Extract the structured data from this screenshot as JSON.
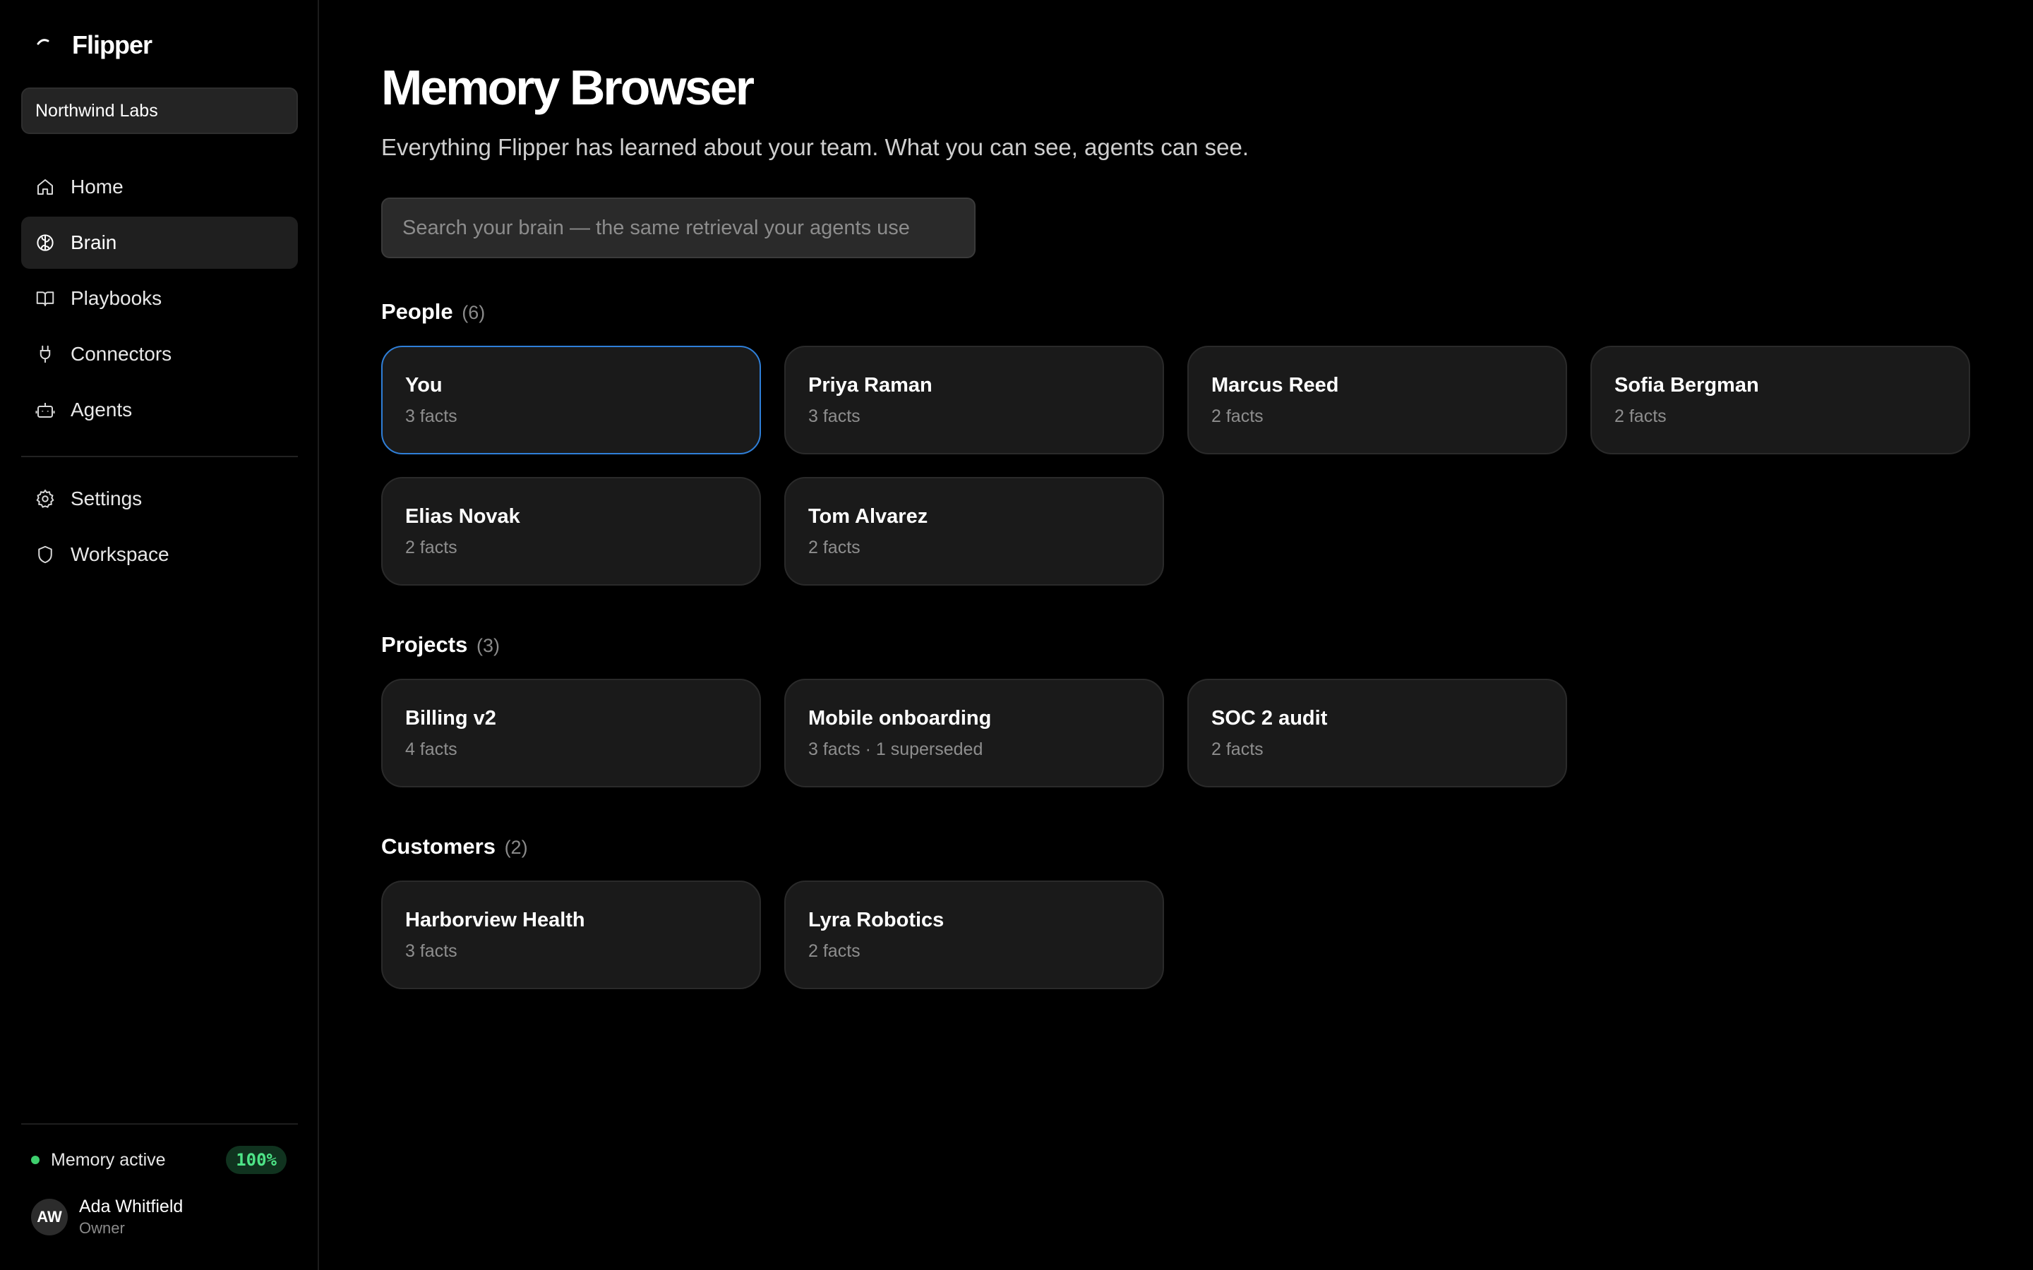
{
  "app": {
    "brand": "Flipper",
    "brand_icon": "flipper-logo-icon"
  },
  "sidebar": {
    "workspace": "Northwind Labs",
    "nav": [
      {
        "label": "Home",
        "icon": "home-icon",
        "active": false
      },
      {
        "label": "Brain",
        "icon": "brain-icon",
        "active": true
      },
      {
        "label": "Playbooks",
        "icon": "book-icon",
        "active": false
      },
      {
        "label": "Connectors",
        "icon": "plug-icon",
        "active": false
      },
      {
        "label": "Agents",
        "icon": "robot-icon",
        "active": false
      }
    ],
    "nav_secondary": [
      {
        "label": "Settings",
        "icon": "gear-icon"
      },
      {
        "label": "Workspace",
        "icon": "shield-icon"
      }
    ],
    "memory": {
      "label": "Memory active",
      "value": "100%",
      "status_color": "#3ecf6e"
    },
    "user": {
      "initials": "AW",
      "name": "Ada Whitfield",
      "role": "Owner"
    }
  },
  "main": {
    "title": "Memory Browser",
    "subtitle": "Everything Flipper has learned about your team. What you can see, agents can see.",
    "search_placeholder": "Search your brain — the same retrieval your agents use",
    "sections": [
      {
        "title": "People",
        "count": "(6)",
        "cards": [
          {
            "title": "You",
            "meta": "3 facts",
            "selected": true
          },
          {
            "title": "Priya Raman",
            "meta": "3 facts"
          },
          {
            "title": "Marcus Reed",
            "meta": "2 facts"
          },
          {
            "title": "Sofia Bergman",
            "meta": "2 facts"
          },
          {
            "title": "Elias Novak",
            "meta": "2 facts"
          },
          {
            "title": "Tom Alvarez",
            "meta": "2 facts"
          }
        ]
      },
      {
        "title": "Projects",
        "count": "(3)",
        "cards": [
          {
            "title": "Billing v2",
            "meta": "4 facts"
          },
          {
            "title": "Mobile onboarding",
            "meta": "3 facts · 1 superseded"
          },
          {
            "title": "SOC 2 audit",
            "meta": "2 facts"
          }
        ]
      },
      {
        "title": "Customers",
        "count": "(2)",
        "cards": [
          {
            "title": "Harborview Health",
            "meta": "3 facts"
          },
          {
            "title": "Lyra Robotics",
            "meta": "2 facts"
          }
        ]
      }
    ]
  },
  "colors": {
    "background": "#000000",
    "card": "#1a1a1a",
    "selected_border": "#2f7fd8",
    "accent_green": "#4ee487"
  }
}
